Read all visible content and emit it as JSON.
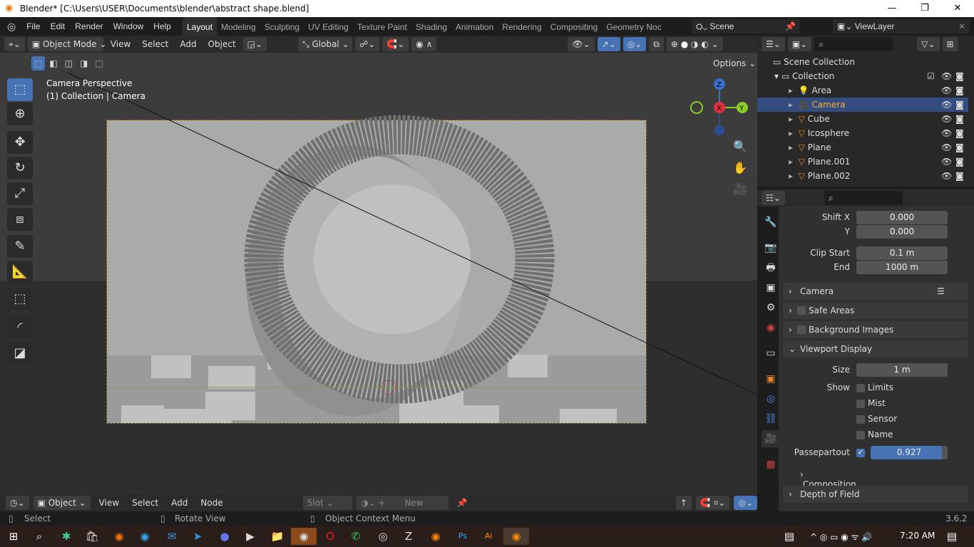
{
  "window": {
    "title": "Blender* [C:\\Users\\USER\\Documents\\blender\\abstract shape.blend]",
    "minimize": "—",
    "maximize": "❐",
    "close": "✕"
  },
  "menu": {
    "items": [
      "File",
      "Edit",
      "Render",
      "Window",
      "Help"
    ],
    "workspaces": [
      "Layout",
      "Modeling",
      "Sculpting",
      "UV Editing",
      "Texture Paint",
      "Shading",
      "Animation",
      "Rendering",
      "Compositing",
      "Geometry Noc"
    ],
    "scene": "Scene",
    "view_layer": "ViewLayer"
  },
  "viewport_header": {
    "mode": "Object Mode",
    "menus": [
      "View",
      "Select",
      "Add",
      "Object"
    ],
    "transform_orientation": "Global",
    "options": "Options"
  },
  "viewport": {
    "overlay_line1": "Camera Perspective",
    "overlay_line2": "(1) Collection | Camera",
    "gizmo": {
      "z": "Z",
      "x": "X",
      "y": "Y"
    }
  },
  "outliner": {
    "scene_collection": "Scene Collection",
    "collection": "Collection",
    "items": [
      {
        "name": "Area",
        "type": "light",
        "selected": false
      },
      {
        "name": "Camera",
        "type": "camera",
        "selected": true
      },
      {
        "name": "Cube",
        "type": "mesh",
        "selected": false
      },
      {
        "name": "Icosphere",
        "type": "mesh",
        "selected": false
      },
      {
        "name": "Plane",
        "type": "mesh",
        "selected": false
      },
      {
        "name": "Plane.001",
        "type": "mesh",
        "selected": false
      },
      {
        "name": "Plane.002",
        "type": "mesh",
        "selected": false
      }
    ]
  },
  "properties": {
    "shift_x_label": "Shift X",
    "shift_x": "0.000",
    "shift_y_label": "Y",
    "shift_y": "0.000",
    "clip_start_label": "Clip Start",
    "clip_start": "0.1 m",
    "clip_end_label": "End",
    "clip_end": "1000 m",
    "panels": {
      "camera": "Camera",
      "safe_areas": "Safe Areas",
      "background_images": "Background Images",
      "viewport_display": "Viewport Display",
      "composition_guides": "Composition Guides",
      "depth_of_field": "Depth of Field"
    },
    "size_label": "Size",
    "size": "1 m",
    "show_label": "Show",
    "show_options": [
      "Limits",
      "Mist",
      "Sensor",
      "Name"
    ],
    "passepartout_label": "Passepartout",
    "passepartout": "0.927",
    "passepartout_fraction": 0.927,
    "accent": "#4772b3"
  },
  "bottom_header": {
    "editor": "Object",
    "menus": [
      "View",
      "Select",
      "Add",
      "Node"
    ],
    "slot": "Slot",
    "new": "New"
  },
  "status": {
    "select": "Select",
    "rotate": "Rotate View",
    "context": "Object Context Menu",
    "version": "3.6.2"
  },
  "taskbar": {
    "time": "7:20 AM"
  }
}
